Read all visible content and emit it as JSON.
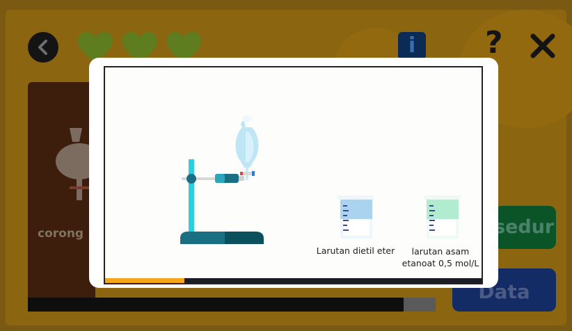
{
  "game": {
    "back_icon": "chevron-left-icon",
    "lives": [
      {
        "icon": "heart-icon",
        "color": "#5d7d1e"
      },
      {
        "icon": "heart-icon",
        "color": "#5d7d1e"
      },
      {
        "icon": "heart-icon",
        "color": "#5d7d1e"
      }
    ],
    "info_label": "i",
    "help_label": "?",
    "close_icon": "close-icon",
    "left_panel_label": "corong",
    "procedure_button_label": "sedur",
    "data_button_label": "Data"
  },
  "modal": {
    "beakers": [
      {
        "label": "Larutan dietil eter",
        "liquid_color": "#a9d3ef"
      },
      {
        "label": "larutan asam etanoat 0,5 mol/L",
        "liquid_color": "#b2ecd0"
      }
    ],
    "animation_progress": 0.21
  },
  "colors": {
    "stand_teal": "#2ad0e0",
    "clamp_dark": "#1b6f82",
    "base_dark": "#0c4f5d",
    "funnel_blue": "#bfe6f5",
    "progress_orange": "#f4a51c"
  }
}
